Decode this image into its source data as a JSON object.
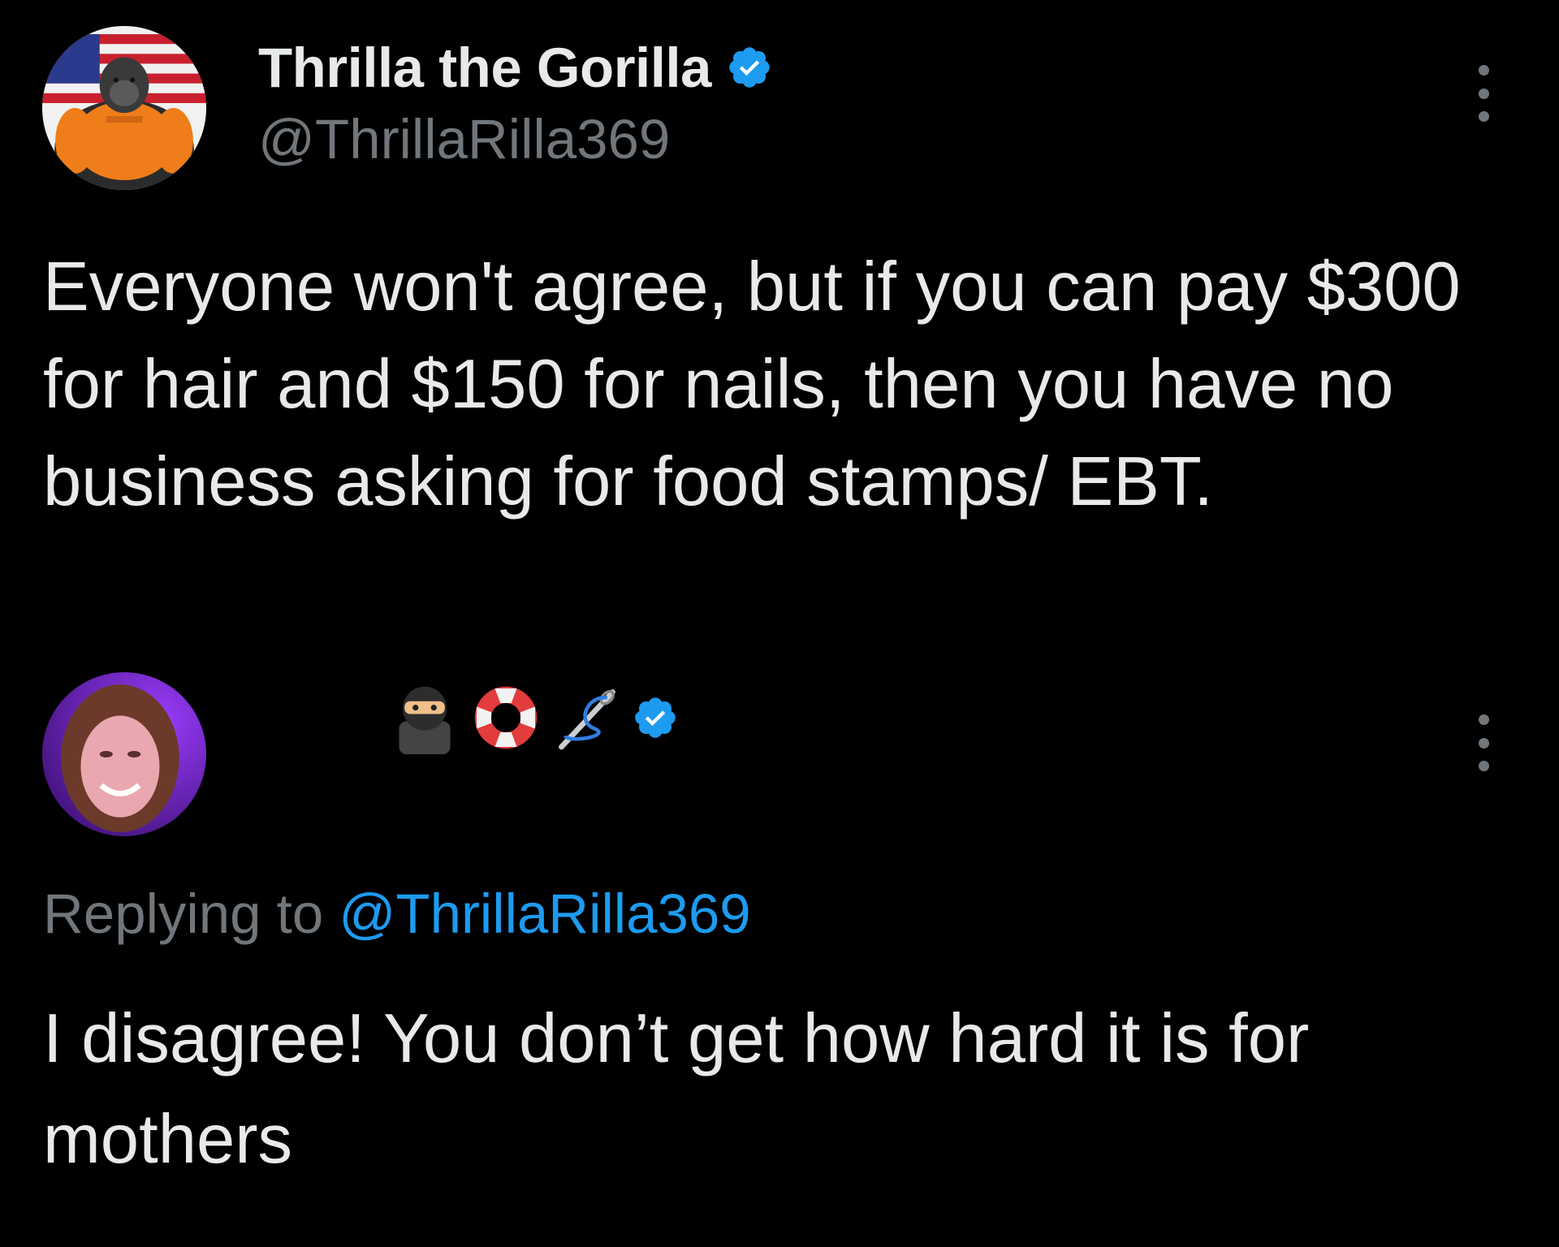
{
  "colors": {
    "background": "#000000",
    "primary_text": "#e7e9ea",
    "secondary_text": "#71767b",
    "link": "#1d9bf0",
    "verified_badge": "#1d9bf0"
  },
  "tweet": {
    "author": {
      "display_name": "Thrilla the Gorilla",
      "handle": "@ThrillaRilla369",
      "verified": true,
      "avatar": "gorilla-avatar"
    },
    "text": "Everyone won't agree, but if you can pay $300 for hair and $150 for nails, then you have no business asking for food stamps/ EBT.",
    "more_icon": "more-options-icon"
  },
  "reply": {
    "author": {
      "display_name": "",
      "name_emojis": [
        "ninja-emoji",
        "ring-buoy-emoji",
        "needle-thread-emoji"
      ],
      "verified": true,
      "avatar": "user-photo-avatar"
    },
    "replying_to_label": "Replying to",
    "replying_to_handle": "@ThrillaRilla369",
    "text": "I disagree!  You don’t get how hard it is for mothers",
    "more_icon": "more-options-icon"
  }
}
